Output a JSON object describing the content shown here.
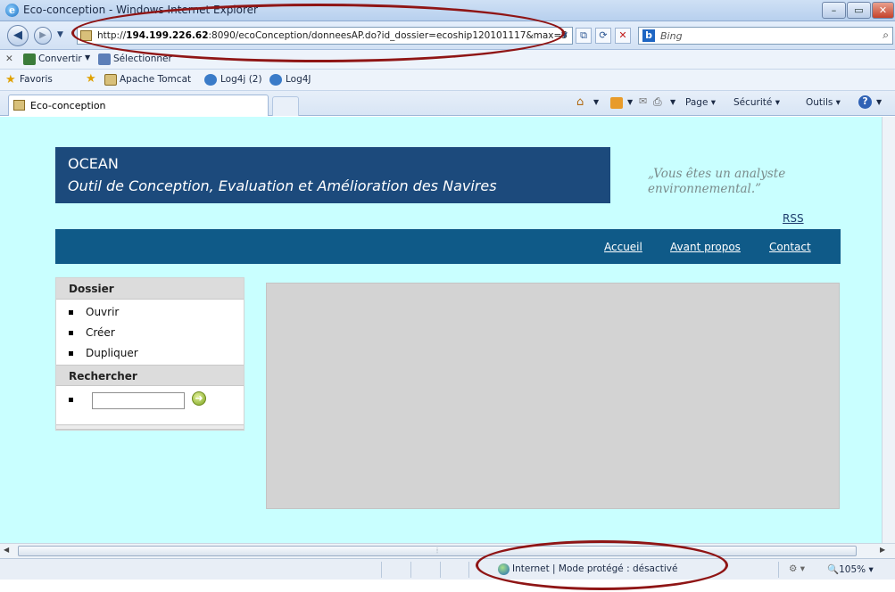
{
  "window": {
    "title": "Eco-conception - Windows Internet Explorer"
  },
  "navbar": {
    "url_prefix": "http://",
    "url_host": "194.199.226.62",
    "url_rest": ":8090/ecoConception/donneesAP.do?id_dossier=ecoship120101117&max=5",
    "search_placeholder": "Bing"
  },
  "command_bar": {
    "convert": "Convertir",
    "select": "Sélectionner"
  },
  "favorites_bar": {
    "favorites": "Favoris",
    "items": [
      "Apache Tomcat",
      "Log4j (2)",
      "Log4J"
    ]
  },
  "tab": {
    "label": "Eco-conception"
  },
  "toolbar": {
    "page": "Page",
    "security": "Sécurité",
    "tools": "Outils"
  },
  "site": {
    "name": "OCEAN",
    "subtitle": "Outil de Conception, Evaluation et Amélioration des Navires",
    "quote": "„Vous êtes un analyste environnemental.”",
    "rss": "RSS",
    "nav": [
      "Accueil",
      "Avant propos",
      "Contact"
    ]
  },
  "sidebar": {
    "dossier_title": "Dossier",
    "dossier_items": [
      "Ouvrir",
      "Créer",
      "Dupliquer"
    ],
    "search_title": "Rechercher",
    "search_value": ""
  },
  "status": {
    "zone": "Internet | Mode protégé : désactivé",
    "zoom": "105%"
  },
  "colors": {
    "page_bg": "#c9ffff",
    "header_bg": "#1c4a7c",
    "nav_bg": "#0f5a88",
    "panel_bg": "#d3d3d3",
    "annotation": "#8f1515"
  }
}
